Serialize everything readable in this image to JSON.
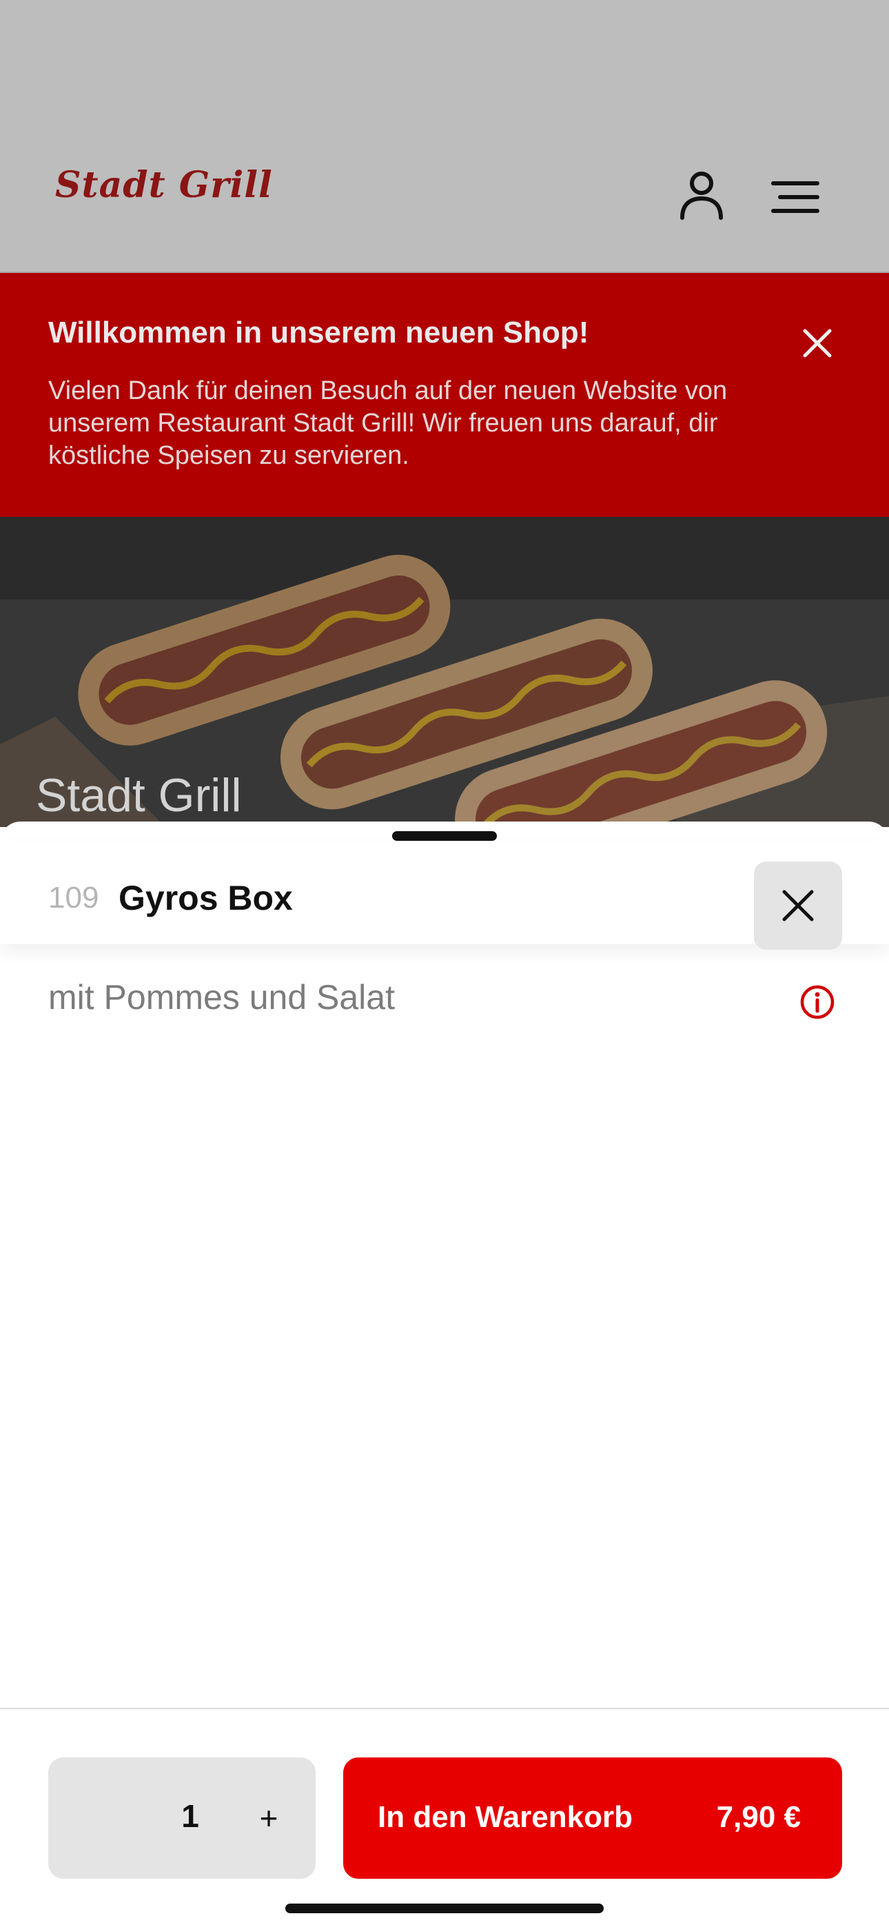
{
  "header": {
    "logo_text": "Stadt Grill",
    "user_icon": "user-icon",
    "menu_icon": "hamburger-menu-icon"
  },
  "banner": {
    "title": "Willkommen in unserem neuen Shop!",
    "text": "Vielen Dank für deinen Besuch auf der neuen Website von unserem Restaurant Stadt Grill! Wir freuen uns darauf, dir köstliche Speisen zu servieren.",
    "close_icon": "close-icon",
    "color": "#b00000"
  },
  "hero": {
    "title": "Stadt Grill",
    "image": "hot-dogs-photo"
  },
  "item": {
    "number": "109",
    "name": "Gyros Box",
    "description": "mit Pommes und Salat",
    "info_icon": "info-icon"
  },
  "footer": {
    "quantity": "1",
    "plus_label": "+",
    "cart_label": "In den Warenkorb",
    "price": "7,90 €",
    "accent": "#e60000"
  }
}
